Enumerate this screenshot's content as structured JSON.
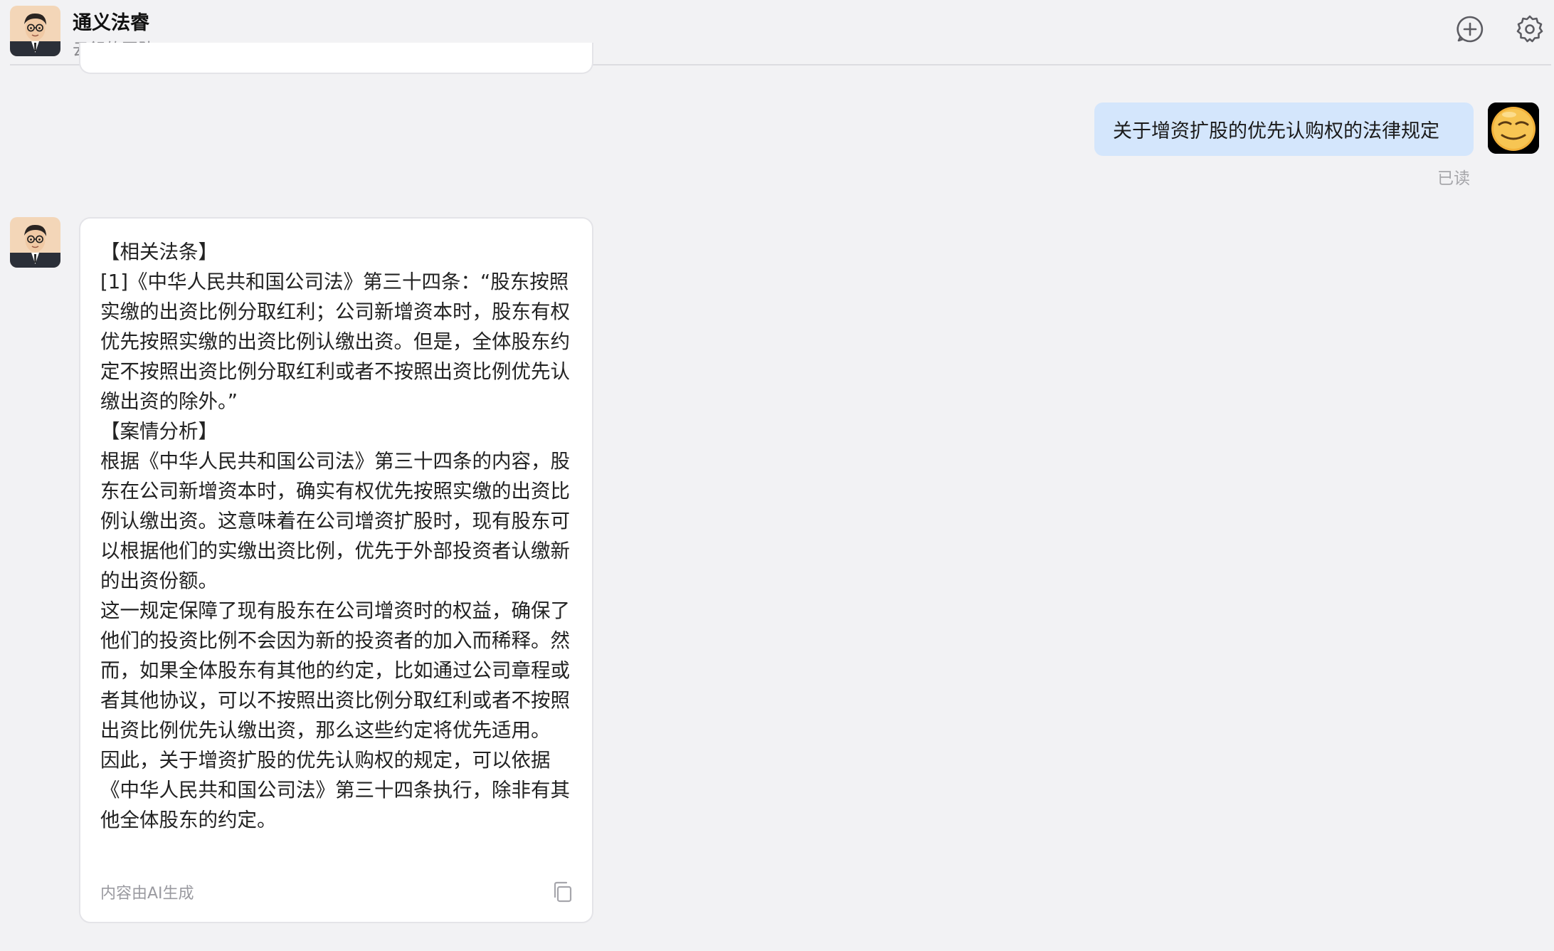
{
  "header": {
    "title": "通义法睿",
    "subtitle": "云舒的团队"
  },
  "icons": {
    "new_chat": "plus-circle-icon",
    "settings": "gear-icon",
    "copy": "copy-icon"
  },
  "messages": {
    "user": {
      "text": "关于增资扩股的优先认购权的法律规定",
      "status": "已读"
    },
    "assistant": {
      "paragraphs": [
        "【相关法条】",
        "[1]《中华人民共和国公司法》第三十四条：“股东按照实缴的出资比例分取红利；公司新增资本时，股东有权优先按照实缴的出资比例认缴出资。但是，全体股东约定不按照出资比例分取红利或者不按照出资比例优先认缴出资的除外。”",
        "【案情分析】",
        "根据《中华人民共和国公司法》第三十四条的内容，股东在公司新增资本时，确实有权优先按照实缴的出资比例认缴出资。这意味着在公司增资扩股时，现有股东可以根据他们的实缴出资比例，优先于外部投资者认缴新的出资份额。",
        "这一规定保障了现有股东在公司增资时的权益，确保了他们的投资比例不会因为新的投资者的加入而稀释。然而，如果全体股东有其他的约定，比如通过公司章程或者其他协议，可以不按照出资比例分取红利或者不按照出资比例优先认缴出资，那么这些约定将优先适用。",
        "因此，关于增资扩股的优先认购权的规定，可以依据《中华人民共和国公司法》第三十四条执行，除非有其他全体股东的约定。"
      ],
      "footer": "内容由AI生成"
    }
  },
  "colors": {
    "background": "#f2f2f4",
    "user_bubble": "#d4e6fc",
    "ai_bubble": "#ffffff",
    "muted_text": "#9a9aa0"
  }
}
